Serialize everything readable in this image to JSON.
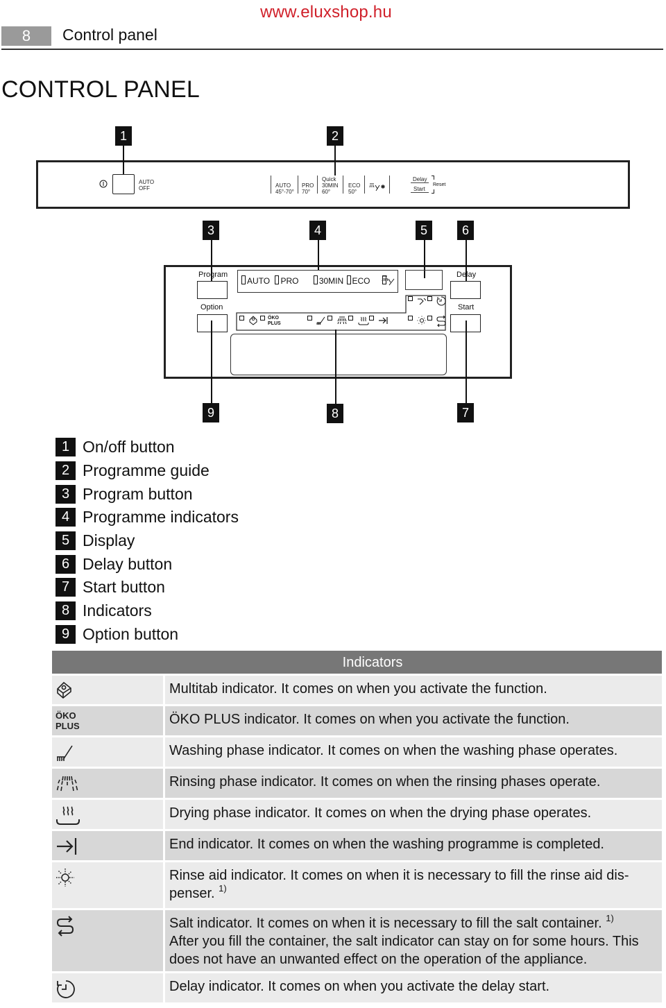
{
  "header": {
    "site_url": "www.eluxshop.hu",
    "page_number": "8",
    "section": "Control panel"
  },
  "title": "CONTROL PANEL",
  "diagram": {
    "callouts": [
      "1",
      "2",
      "3",
      "4",
      "5",
      "6",
      "7",
      "8",
      "9"
    ],
    "panel_top": {
      "power_symbol": "ⓘ",
      "auto_off": [
        "AUTO",
        "OFF"
      ],
      "programmes": [
        {
          "line1": "AUTO",
          "line2": "45°-70°"
        },
        {
          "line1": "PRO",
          "line2": "70°"
        },
        {
          "line0": "Quick",
          "line1": "30MIN",
          "line2": "60°"
        },
        {
          "line1": "ECO",
          "line2": "50°"
        }
      ],
      "rinse_symbol": " y*",
      "delay_label": "Delay",
      "start_label": "Start",
      "reset_label": "Reset"
    },
    "panel_bottom": {
      "program_label": "Program",
      "option_label": "Option",
      "delay_label": "Delay",
      "start_label": "Start",
      "programme_indicators": [
        "AUTO",
        "PRO",
        "30MIN",
        "ECO"
      ],
      "oko_plus": [
        "ÖKO",
        "PLUS"
      ]
    }
  },
  "legend": [
    {
      "num": "1",
      "label": "On/off button"
    },
    {
      "num": "2",
      "label": "Programme guide"
    },
    {
      "num": "3",
      "label": "Program button"
    },
    {
      "num": "4",
      "label": "Programme indicators"
    },
    {
      "num": "5",
      "label": "Display"
    },
    {
      "num": "6",
      "label": "Delay button"
    },
    {
      "num": "7",
      "label": "Start button"
    },
    {
      "num": "8",
      "label": "Indicators"
    },
    {
      "num": "9",
      "label": "Option button"
    }
  ],
  "indicators_table": {
    "header": "Indicators",
    "rows": [
      {
        "icon": "multitab-icon",
        "text": "Multitab indicator. It comes on when you activate the function."
      },
      {
        "icon": "oko-plus-icon",
        "icon_text": [
          "ÖKO",
          "PLUS"
        ],
        "text": "ÖKO PLUS indicator. It comes on when you activate the function."
      },
      {
        "icon": "washing-phase-icon",
        "text": "Washing phase indicator. It comes on when the washing phase operates."
      },
      {
        "icon": "rinsing-phase-icon",
        "text": "Rinsing phase indicator. It comes on when the rinsing phases operate."
      },
      {
        "icon": "drying-phase-icon",
        "text": "Drying phase indicator. It comes on when the drying phase operates."
      },
      {
        "icon": "end-icon",
        "text": "End indicator. It comes on when the washing programme is completed."
      },
      {
        "icon": "rinse-aid-icon",
        "text": "Rinse aid indicator. It comes on when it is necessary to fill the rinse aid dis-penser.",
        "footnote": "1)"
      },
      {
        "icon": "salt-icon",
        "text": "Salt indicator. It comes on when it is necessary to fill the salt container.",
        "footnote": "1)",
        "text2": "After you fill the container, the salt indicator can stay on for some hours. This does not have an unwanted effect on the operation of the appliance."
      },
      {
        "icon": "delay-icon",
        "text": "Delay indicator. It comes on when you activate the delay start."
      }
    ]
  }
}
